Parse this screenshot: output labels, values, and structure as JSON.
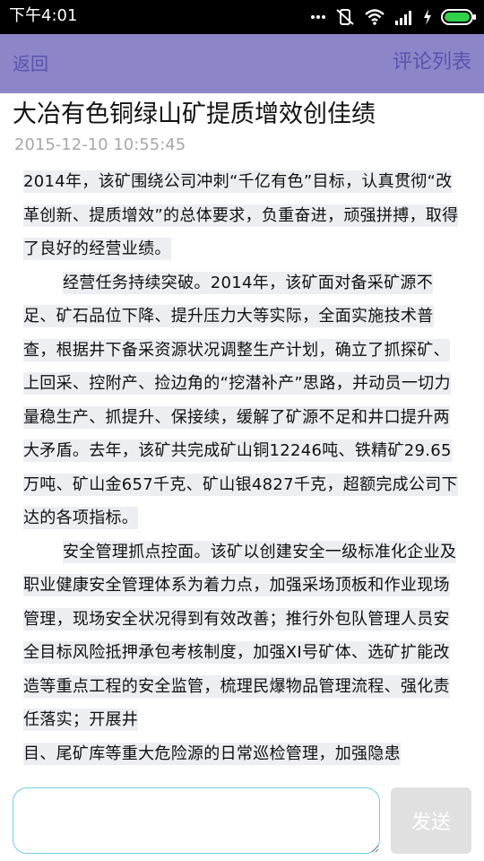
{
  "status_bar": {
    "time": "下午4:01",
    "icons": [
      "signal-dots-icon",
      "vibrate-off-icon",
      "wifi-icon",
      "cell-signal-icon",
      "charging-icon",
      "battery-icon"
    ]
  },
  "app_bar": {
    "back_label": "返回",
    "comment_list_label": "评论列表",
    "background_color": "#8c86c9",
    "text_color": "#5a53ad"
  },
  "article": {
    "title": "大冶有色铜绿山矿提质增效创佳绩",
    "timestamp": "2015-12-10 10:55:45",
    "paragraphs": [
      "2014年，该矿围绕公司冲刺“千亿有色”目标，认真贯彻“改革创新、提质增效”的总体要求，负重奋进，顽强拼搏，取得了良好的经营业绩。",
      "经营任务持续突破。2014年，该矿面对备采矿源不足、矿石品位下降、提升压力大等实际，全面实施技术普查，根据井下备采资源状况调整生产计划，确立了抓探矿、上回采、控附产、捡边角的“挖潜补产”思路，并动员一切力量稳生产、抓提升、保接续，缓解了矿源不足和井口提升两大矛盾。去年，该矿共完成矿山铜12246吨、铁精矿29.65 万吨、矿山金657千克、矿山银4827千克，超额完成公司下达的各项指标。",
      "安全管理抓点控面。该矿以创建安全一级标准化企业及职业健康安全管理体系为着力点，加强采场顶板和作业现场管理，现场安全状况得到有效改善；推行外包队管理人员安全目标风险抵押承包考核制度，加强XI号矿体、选矿扩能改造等重点工程的安全监管，梳理民爆物品管理流程、强化责任落实；开展井",
      "目、尾矿库等重大危险源的日常巡检管理，加强隐患"
    ]
  },
  "comment_bar": {
    "input_value": "",
    "send_label": "发送",
    "input_border_color": "#6fd0e0"
  }
}
